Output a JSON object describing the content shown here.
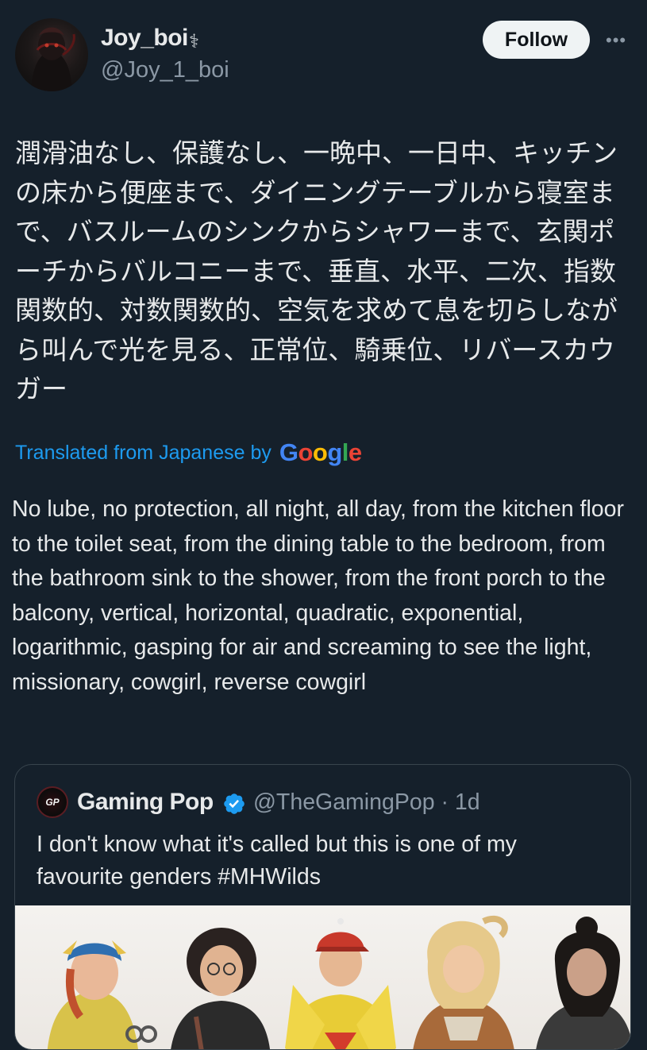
{
  "post": {
    "author": {
      "display_name": "Joy_boi",
      "name_glyph": "⚕",
      "handle": "@Joy_1_boi",
      "avatar_icon": "dark-figure-avatar"
    },
    "follow_label": "Follow",
    "more_icon": "more-horizontal-icon",
    "text_original": "潤滑油なし、保護なし、一晩中、一日中、キッチンの床から便座まで、ダイニングテーブルから寝室まで、バスルームのシンクからシャワーまで、玄関ポーチからバルコニーまで、垂直、水平、二次、指数関数的、対数関数的、空気を求めて息を切らしながら叫んで光を見る、正常位、騎乗位、リバースカウガー",
    "translation_label": "Translated from Japanese by",
    "translation_provider": "Google",
    "text_translated": "No lube, no protection, all night, all day, from the kitchen floor to the toilet seat, from the dining table to the bedroom, from the bathroom sink to the shower, from the front porch to the balcony, vertical, horizontal, quadratic, exponential, logarithmic, gasping for air and screaming to see the light, missionary, cowgirl, reverse cowgirl"
  },
  "quote": {
    "avatar_text": "GP",
    "display_name": "Gaming Pop",
    "verified_icon": "verified-badge-icon",
    "handle_time": "@TheGamingPop · 1d",
    "text": "I don't know what it's called but this is one of my favourite genders #MHWilds",
    "media_icon": "character-lineup-image"
  },
  "colors": {
    "background": "#15202b",
    "text_primary": "#e7e9ea",
    "text_secondary": "#8b98a5",
    "link": "#1d9bf0",
    "border": "#38444d",
    "follow_bg": "#eff3f4"
  }
}
